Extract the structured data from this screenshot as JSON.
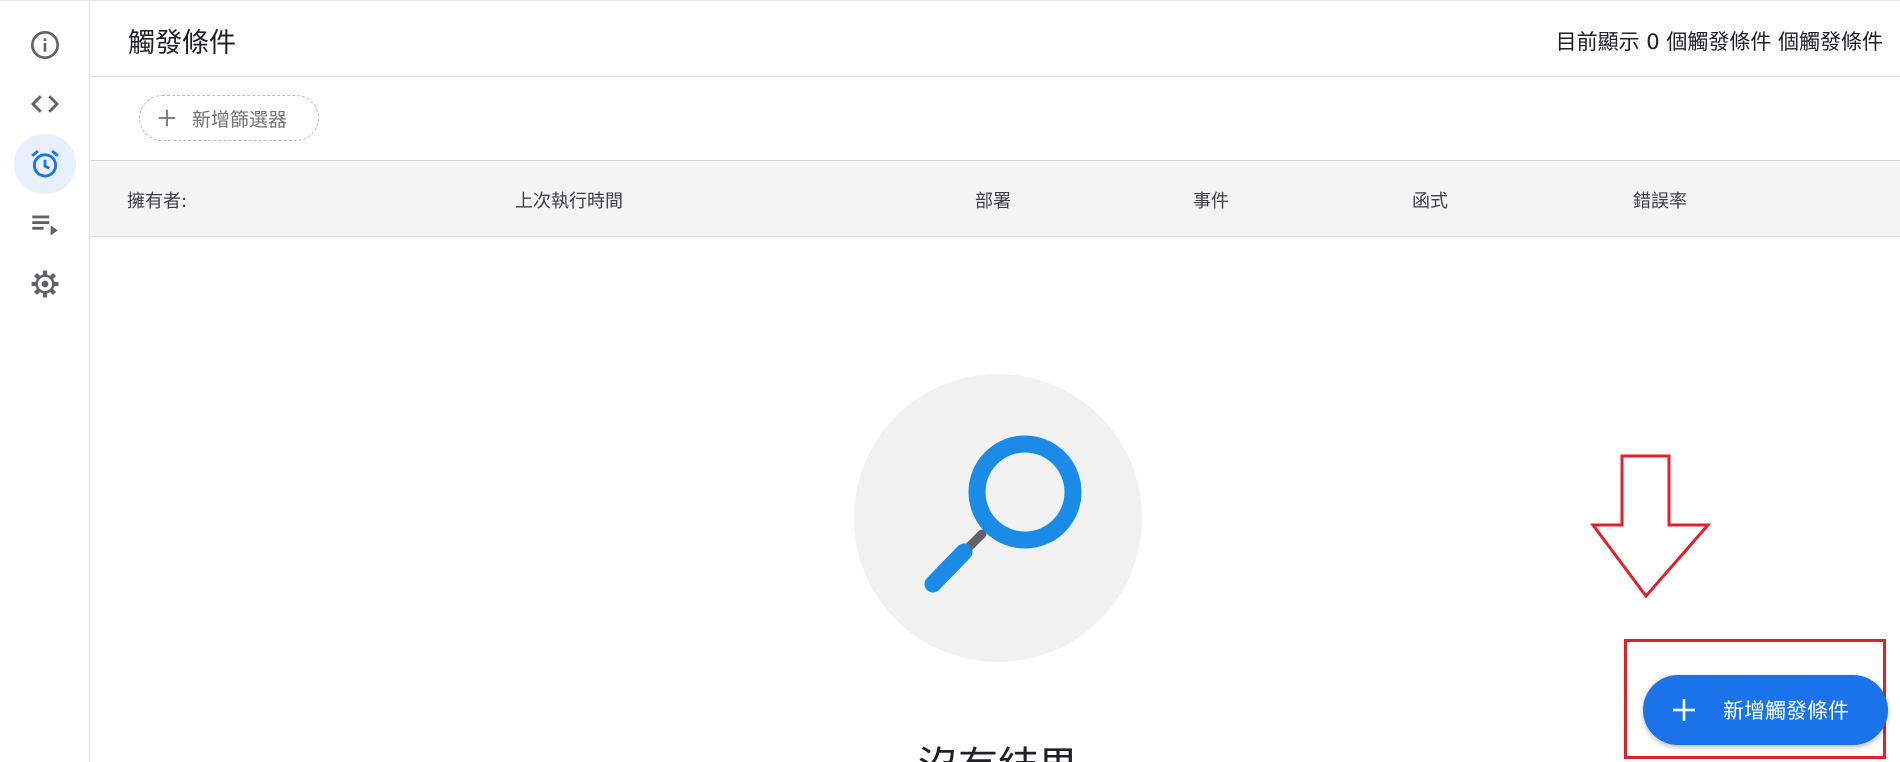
{
  "header": {
    "title": "觸發條件",
    "count_text": "目前顯示 0 個觸發條件 個觸發條件"
  },
  "sidebar": {
    "items": [
      {
        "icon": "info-icon",
        "active": false
      },
      {
        "icon": "code-icon",
        "active": false
      },
      {
        "icon": "alarm-clock-icon",
        "active": true
      },
      {
        "icon": "playlist-play-icon",
        "active": false
      },
      {
        "icon": "gear-icon",
        "active": false
      }
    ]
  },
  "filter": {
    "add_filter_label": "新增篩選器"
  },
  "table": {
    "columns": [
      "擁有者:",
      "上次執行時間",
      "部署",
      "事件",
      "函式",
      "錯誤率"
    ]
  },
  "empty_state": {
    "text": "沒有結果"
  },
  "fab": {
    "label": "新增觸發條件"
  },
  "colors": {
    "accent": "#1a73e8",
    "active_rail": "#e8f0fe",
    "annotation": "#e0202a",
    "magnifier": "#1a8ce8"
  }
}
